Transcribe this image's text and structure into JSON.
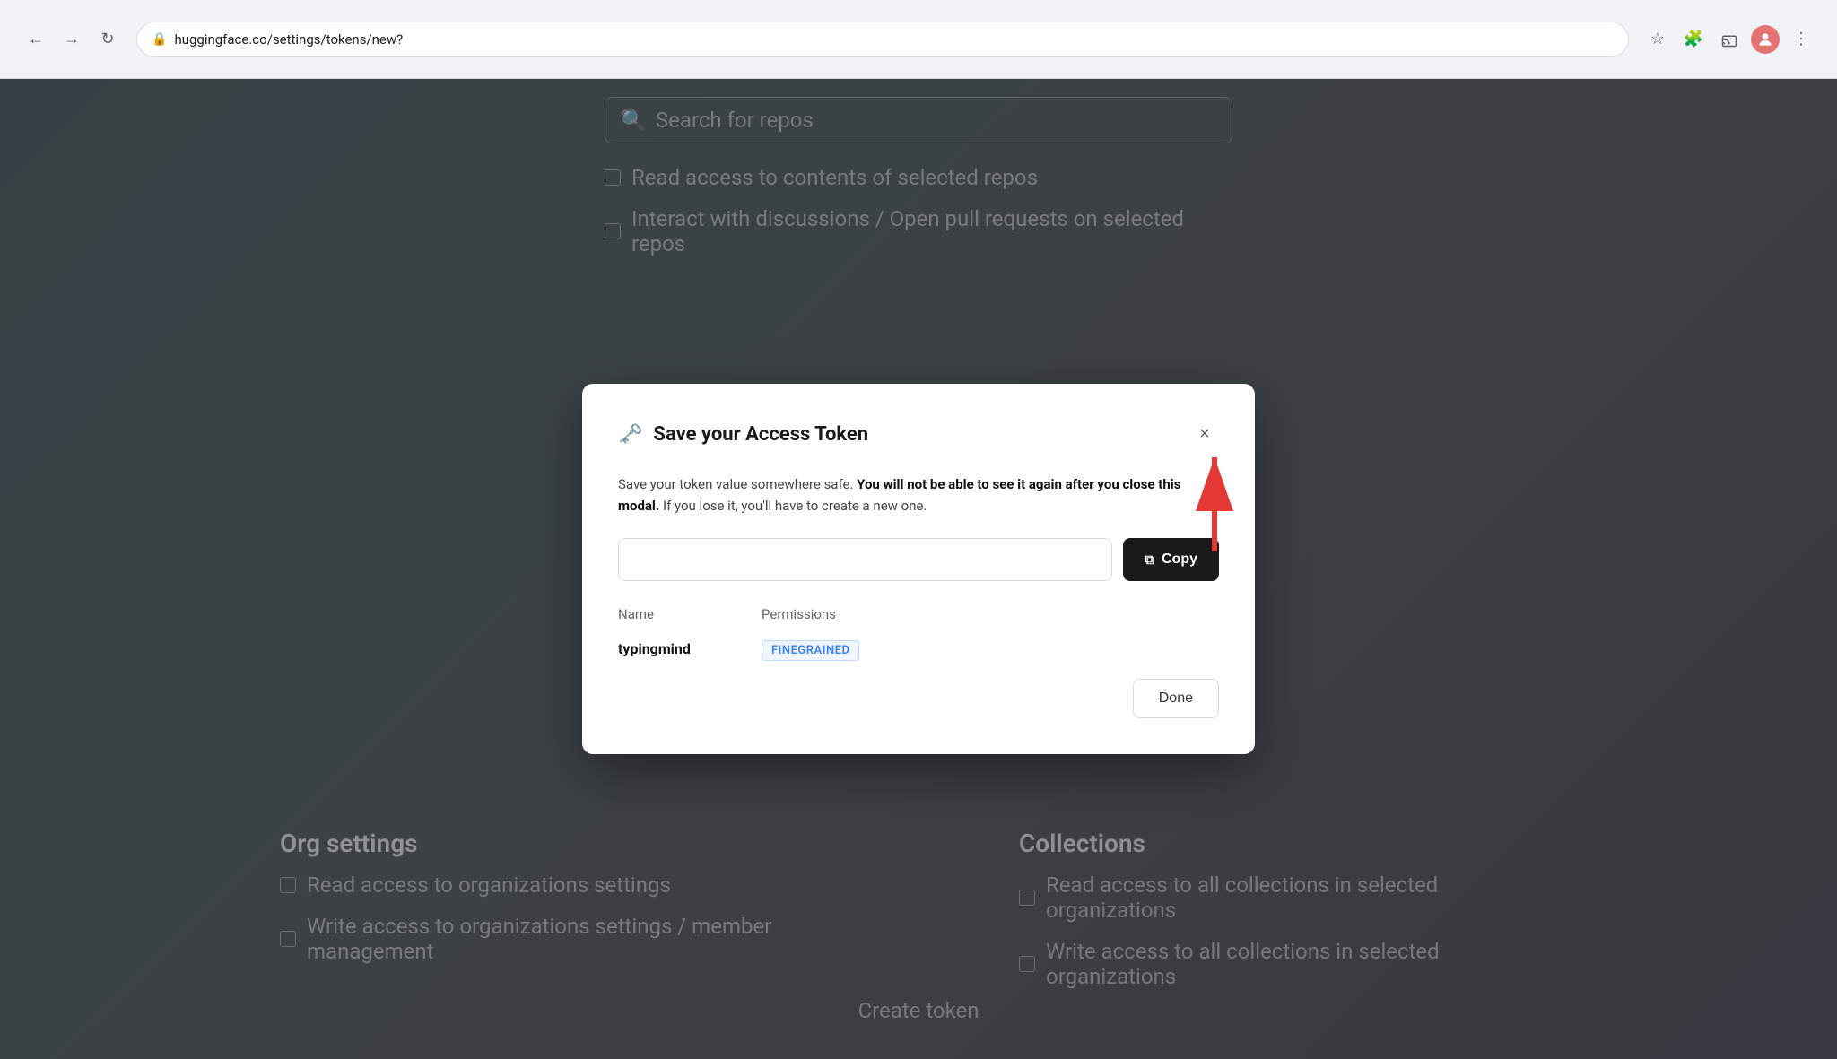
{
  "browser": {
    "url": "huggingface.co/settings/tokens/new?",
    "nav": {
      "back": "←",
      "forward": "→",
      "refresh": "↻",
      "info_icon": "🔒"
    },
    "actions": {
      "star": "☆",
      "extensions": "🧩",
      "cast": "⊡",
      "menu": "⋮"
    }
  },
  "background": {
    "search_placeholder": "Search for repos",
    "items": [
      "Read access to contents of selected repos",
      "Interact with discussions / Open pull requests on selected repos"
    ],
    "bottom_left": {
      "title": "Org settings",
      "items": [
        "Read access to organizations settings",
        "Write access to organizations settings / member management"
      ]
    },
    "bottom_right": {
      "title": "Collections",
      "items": [
        "Read access to all collections in selected organizations",
        "Write access to all collections in selected organizations"
      ]
    },
    "create_token_label": "Create token"
  },
  "modal": {
    "title": "Save your Access Token",
    "close_label": "×",
    "description_normal": "Save your token value somewhere safe.",
    "description_bold": "You will not be able to see it again after you close this modal.",
    "description_suffix": " If you lose it, you'll have to create a new one.",
    "token_value": "",
    "token_placeholder": "",
    "copy_button_label": "Copy",
    "table": {
      "name_header": "Name",
      "permissions_header": "Permissions",
      "token_name": "typingmind",
      "permissions_badge": "FINEGRAINED"
    },
    "done_button_label": "Done"
  }
}
